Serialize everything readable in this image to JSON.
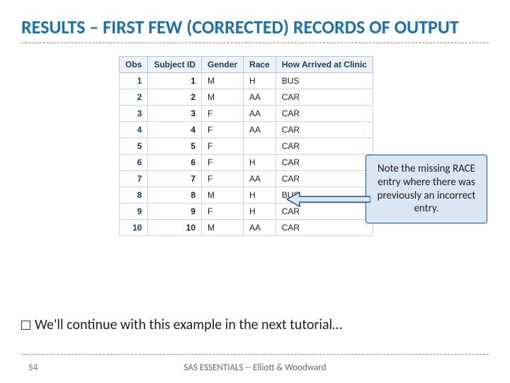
{
  "title": "RESULTS – FIRST FEW (CORRECTED) RECORDS OF OUTPUT",
  "table": {
    "headers": [
      "Obs",
      "Subject ID",
      "Gender",
      "Race",
      "How Arrived at Clinic"
    ],
    "rows": [
      {
        "obs": "1",
        "subj": "1",
        "gender": "M",
        "race": "H",
        "arrived": "BUS"
      },
      {
        "obs": "2",
        "subj": "2",
        "gender": "M",
        "race": "AA",
        "arrived": "CAR"
      },
      {
        "obs": "3",
        "subj": "3",
        "gender": "F",
        "race": "AA",
        "arrived": "CAR"
      },
      {
        "obs": "4",
        "subj": "4",
        "gender": "F",
        "race": "AA",
        "arrived": "CAR"
      },
      {
        "obs": "5",
        "subj": "5",
        "gender": "F",
        "race": "",
        "arrived": "CAR"
      },
      {
        "obs": "6",
        "subj": "6",
        "gender": "F",
        "race": "H",
        "arrived": "CAR"
      },
      {
        "obs": "7",
        "subj": "7",
        "gender": "F",
        "race": "AA",
        "arrived": "CAR"
      },
      {
        "obs": "8",
        "subj": "8",
        "gender": "M",
        "race": "H",
        "arrived": "BUS"
      },
      {
        "obs": "9",
        "subj": "9",
        "gender": "F",
        "race": "H",
        "arrived": "CAR"
      },
      {
        "obs": "10",
        "subj": "10",
        "gender": "M",
        "race": "AA",
        "arrived": "CAR"
      }
    ]
  },
  "callout": "Note the missing RACE entry where there was previously an incorrect entry.",
  "bullet": "We'll continue with this example in the next tutorial…",
  "footer": {
    "page": "54",
    "credit": "SAS ESSENTIALS -- Elliott & Woodward"
  }
}
